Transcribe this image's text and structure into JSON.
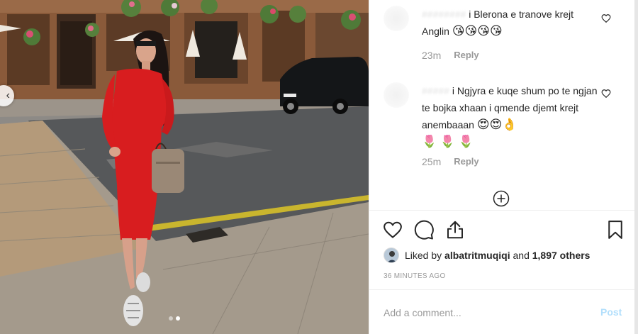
{
  "comments": [
    {
      "username": "########",
      "text": "i Blerona e tranove krejt Anglin",
      "emojis": [
        "😘",
        "😘",
        "😘",
        "😘"
      ],
      "time": "23m",
      "reply_label": "Reply"
    },
    {
      "username": "#####",
      "text": "i Ngjyra e kuqe shum po te ngjan te bojka xhaan i qmende djemt krejt anembaaan",
      "emojis": [
        "😍",
        "😍",
        "👌"
      ],
      "extra_emojis": [
        "🌷",
        "🌷",
        "🌷"
      ],
      "time": "25m",
      "reply_label": "Reply"
    }
  ],
  "likes": {
    "prefix": "Liked by",
    "user": "albatritmuqiqi",
    "conjunction": "and",
    "count_text": "1,897 others"
  },
  "timestamp": "36 MINUTES AGO",
  "add_comment": {
    "placeholder": "Add a comment...",
    "post_label": "Post"
  },
  "carousel": {
    "total": 2,
    "current": 2
  },
  "colors": {
    "dress": "#d81d1f",
    "post_disabled": "#b2dffc",
    "muted": "#999999"
  },
  "icons": [
    "heart-icon",
    "comment-icon",
    "share-icon",
    "bookmark-icon",
    "plus-circle-icon",
    "chevron-left-icon"
  ]
}
